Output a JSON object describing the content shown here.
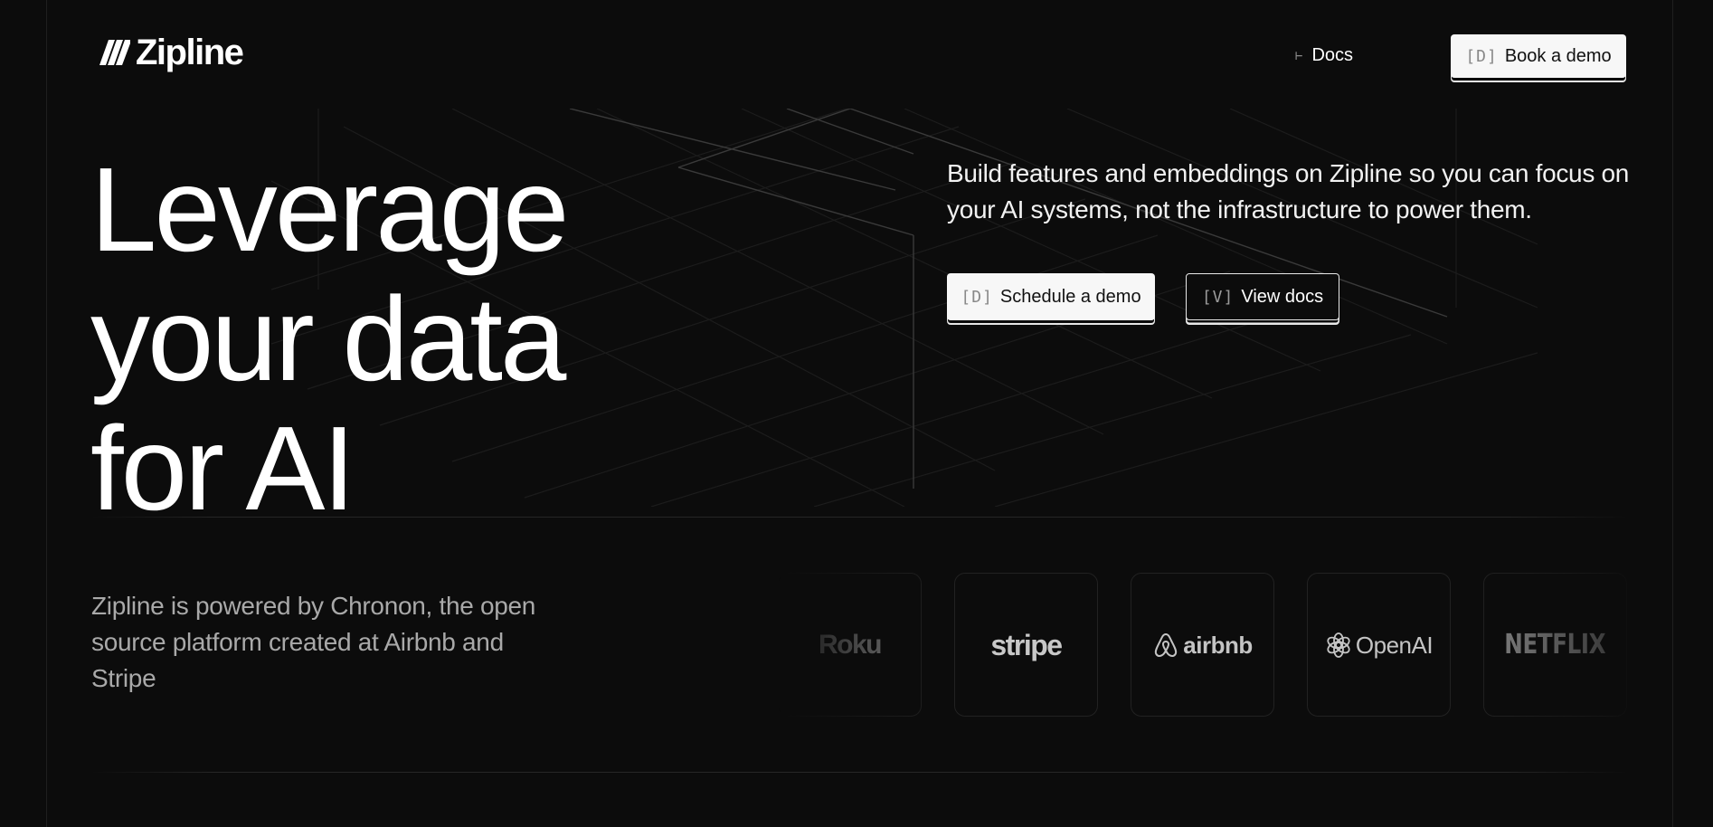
{
  "colors": {
    "background": "#0c0c0c",
    "text_primary": "#ffffff",
    "text_muted": "#a9a9a9",
    "button_light": "#f7f7f7",
    "border": "#222222"
  },
  "header": {
    "logo_text": "Zipline",
    "logo_icon": "zipline-slashes-icon",
    "nav": {
      "docs_prefix": "⊢",
      "docs_label": "Docs"
    },
    "book_demo": {
      "key": "[D]",
      "label": "Book a demo"
    }
  },
  "hero": {
    "title_lines": [
      "Leverage",
      "your data",
      "for AI"
    ],
    "subtitle": "Build features and embeddings on Zipline so you can focus on your AI systems, not the infrastructure to power them.",
    "schedule_demo": {
      "key": "[D]",
      "label": "Schedule a demo"
    },
    "view_docs": {
      "key": "[V]",
      "label": "View docs"
    }
  },
  "powered_by": {
    "text": "Zipline is powered by Chronon, the open source platform created at Airbnb and Stripe"
  },
  "logos": [
    {
      "name": "Roku",
      "icon": "roku-logo"
    },
    {
      "name": "stripe",
      "icon": "stripe-logo"
    },
    {
      "name": "airbnb",
      "icon": "airbnb-logo-icon"
    },
    {
      "name": "OpenAI",
      "icon": "openai-logo-icon"
    },
    {
      "name": "NETFLIX",
      "icon": "netflix-logo"
    }
  ]
}
